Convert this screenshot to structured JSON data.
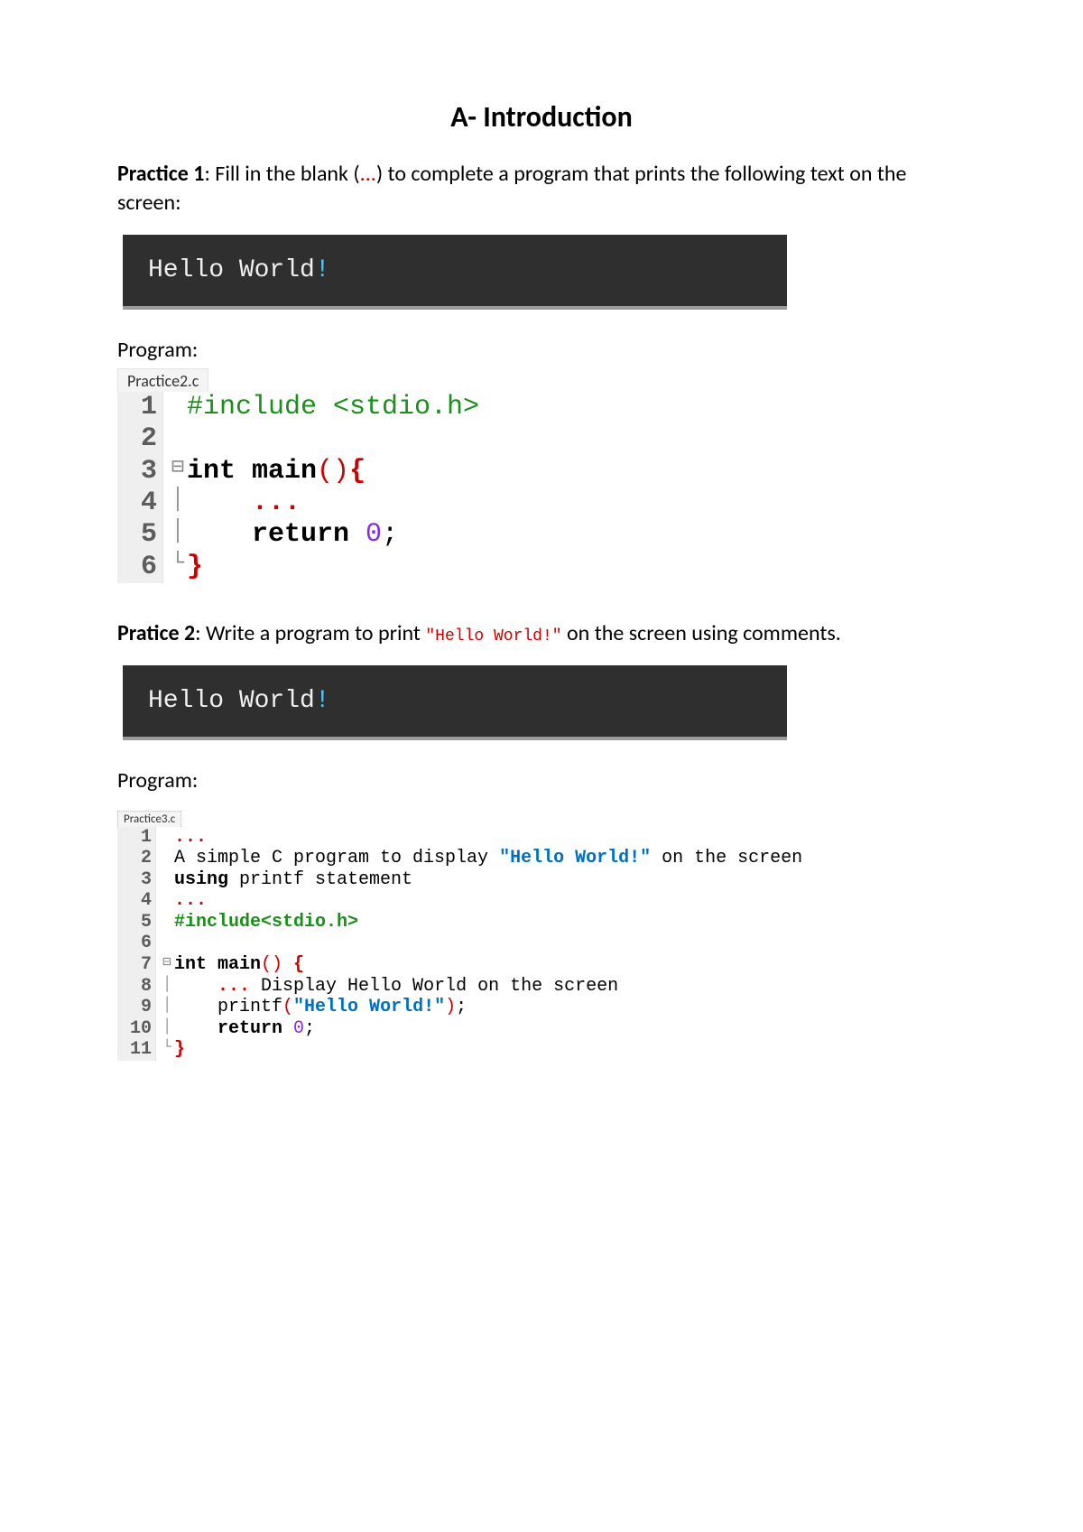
{
  "title": "A- Introduction",
  "practice1": {
    "label": "Practice 1",
    "text_before": ": Fill in the blank (",
    "ellipsis": "...",
    "text_after": ") to complete a program that prints the following text on the screen:"
  },
  "output1": {
    "hello": "Hello World",
    "bang": "!"
  },
  "program_label": "Program:",
  "editor1": {
    "tab": "Practice2.c",
    "lines": {
      "l1": "1",
      "l2": "2",
      "l3": "3",
      "l4": "4",
      "l5": "5",
      "l6": "6",
      "include": "#include <stdio.h>",
      "int_main": "int main",
      "paren_open": "(",
      "paren_close": ")",
      "brace_open": "{",
      "brace_close": "}",
      "dots": "...",
      "return_kw": "return ",
      "zero_semi": "0",
      "semi": ";"
    }
  },
  "practice2": {
    "label": "Pratice 2",
    "text_before": ": Write a program to print ",
    "hello_inline": "\"Hello World!\"",
    "text_after": " on the screen using comments."
  },
  "output2": {
    "hello": "Hello World",
    "bang": "!"
  },
  "editor2": {
    "tab": "Practice3.c",
    "lines": {
      "l1": "1",
      "l2": "2",
      "l3": "3",
      "l4": "4",
      "l5": "5",
      "l6": "6",
      "l7": "7",
      "l8": "8",
      "l9": "9",
      "l10": "10",
      "l11": "11",
      "dots": "...",
      "comment2a": "A simple C program to display ",
      "comment2b": "\"Hello World!\"",
      "comment2c": " on the screen",
      "using": "using",
      "comment3b": " printf statement",
      "include": "#include<stdio.h>",
      "int_main": "int main",
      "paren_open": "(",
      "paren_close": ")",
      "brace_open_sp": " {",
      "brace_close": "}",
      "comment8": " Display Hello World on the screen",
      "printf": "printf",
      "printf_str": "\"Hello World!\"",
      "return_kw": "return ",
      "zero": "0",
      "semi": ";"
    }
  }
}
